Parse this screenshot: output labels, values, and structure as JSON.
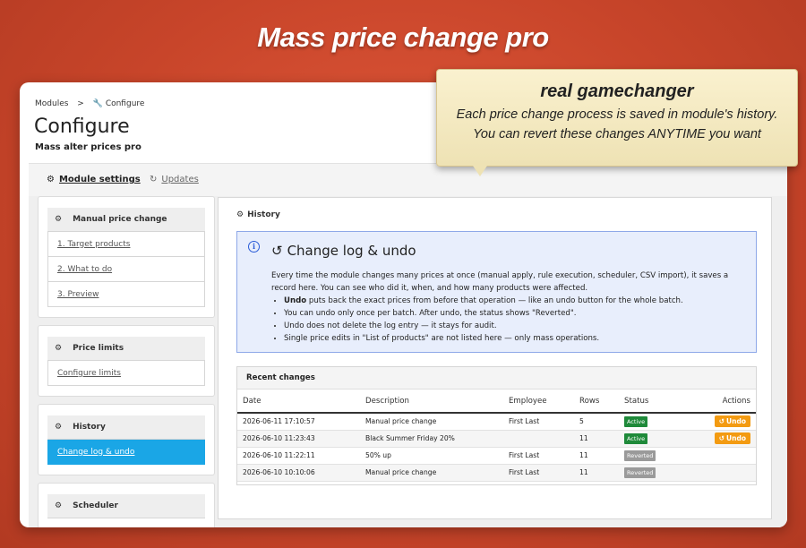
{
  "banner": {
    "title": "Mass price change pro"
  },
  "callout": {
    "title": "real gamechanger",
    "line1": "Each price change process is saved in module's history.",
    "line2": "You can revert these changes ANYTIME you want"
  },
  "breadcrumb": {
    "parent": "Modules",
    "separator": ">",
    "current": "Configure"
  },
  "page": {
    "title": "Configure",
    "subtitle": "Mass alter prices pro"
  },
  "tabs": [
    {
      "label": "Module settings",
      "icon": "gears-icon"
    },
    {
      "label": "Updates",
      "icon": "refresh-icon"
    }
  ],
  "sidebar": {
    "manual": {
      "title": "Manual price change",
      "items": [
        "1. Target products",
        "2. What to do",
        "3. Preview"
      ]
    },
    "limits": {
      "title": "Price limits",
      "items": [
        "Configure limits"
      ]
    },
    "history": {
      "title": "History",
      "items": [
        "Change log & undo"
      ]
    },
    "scheduler": {
      "title": "Scheduler"
    }
  },
  "main": {
    "heading": "History",
    "info": {
      "title": "Change log & undo",
      "description": "Every time the module changes many prices at once (manual apply, rule execution, scheduler, CSV import), it saves a record here. You can see who did it, when, and how many products were affected.",
      "bullet1_bold": "Undo",
      "bullet1_rest": " puts back the exact prices from before that operation — like an undo button for the whole batch.",
      "bullet2": "You can undo only once per batch. After undo, the status shows \"Reverted\".",
      "bullet3": "Undo does not delete the log entry — it stays for audit.",
      "bullet4": "Single price edits in \"List of products\" are not listed here — only mass operations."
    },
    "recent": {
      "title": "Recent changes",
      "columns": [
        "Date",
        "Description",
        "Employee",
        "Rows",
        "Status",
        "Actions"
      ],
      "undo_label": "Undo",
      "rows": [
        {
          "date": "2026-06-11 17:10:57",
          "description": "Manual price change",
          "employee": "First Last",
          "rows": "5",
          "status": "Active",
          "undo": true
        },
        {
          "date": "2026-06-10 11:23:43",
          "description": "Black Summer Friday 20%",
          "employee": "",
          "rows": "11",
          "status": "Active",
          "undo": true
        },
        {
          "date": "2026-06-10 11:22:11",
          "description": "50% up",
          "employee": "First Last",
          "rows": "11",
          "status": "Reverted",
          "undo": false
        },
        {
          "date": "2026-06-10 10:10:06",
          "description": "Manual price change",
          "employee": "First Last",
          "rows": "11",
          "status": "Reverted",
          "undo": false
        }
      ]
    }
  },
  "colors": {
    "active": "#1f8a3a",
    "reverted": "#9a9a9a",
    "undo": "#f39b12",
    "sidebar_active": "#1aa6e6",
    "info_border": "#8ea8e8"
  }
}
